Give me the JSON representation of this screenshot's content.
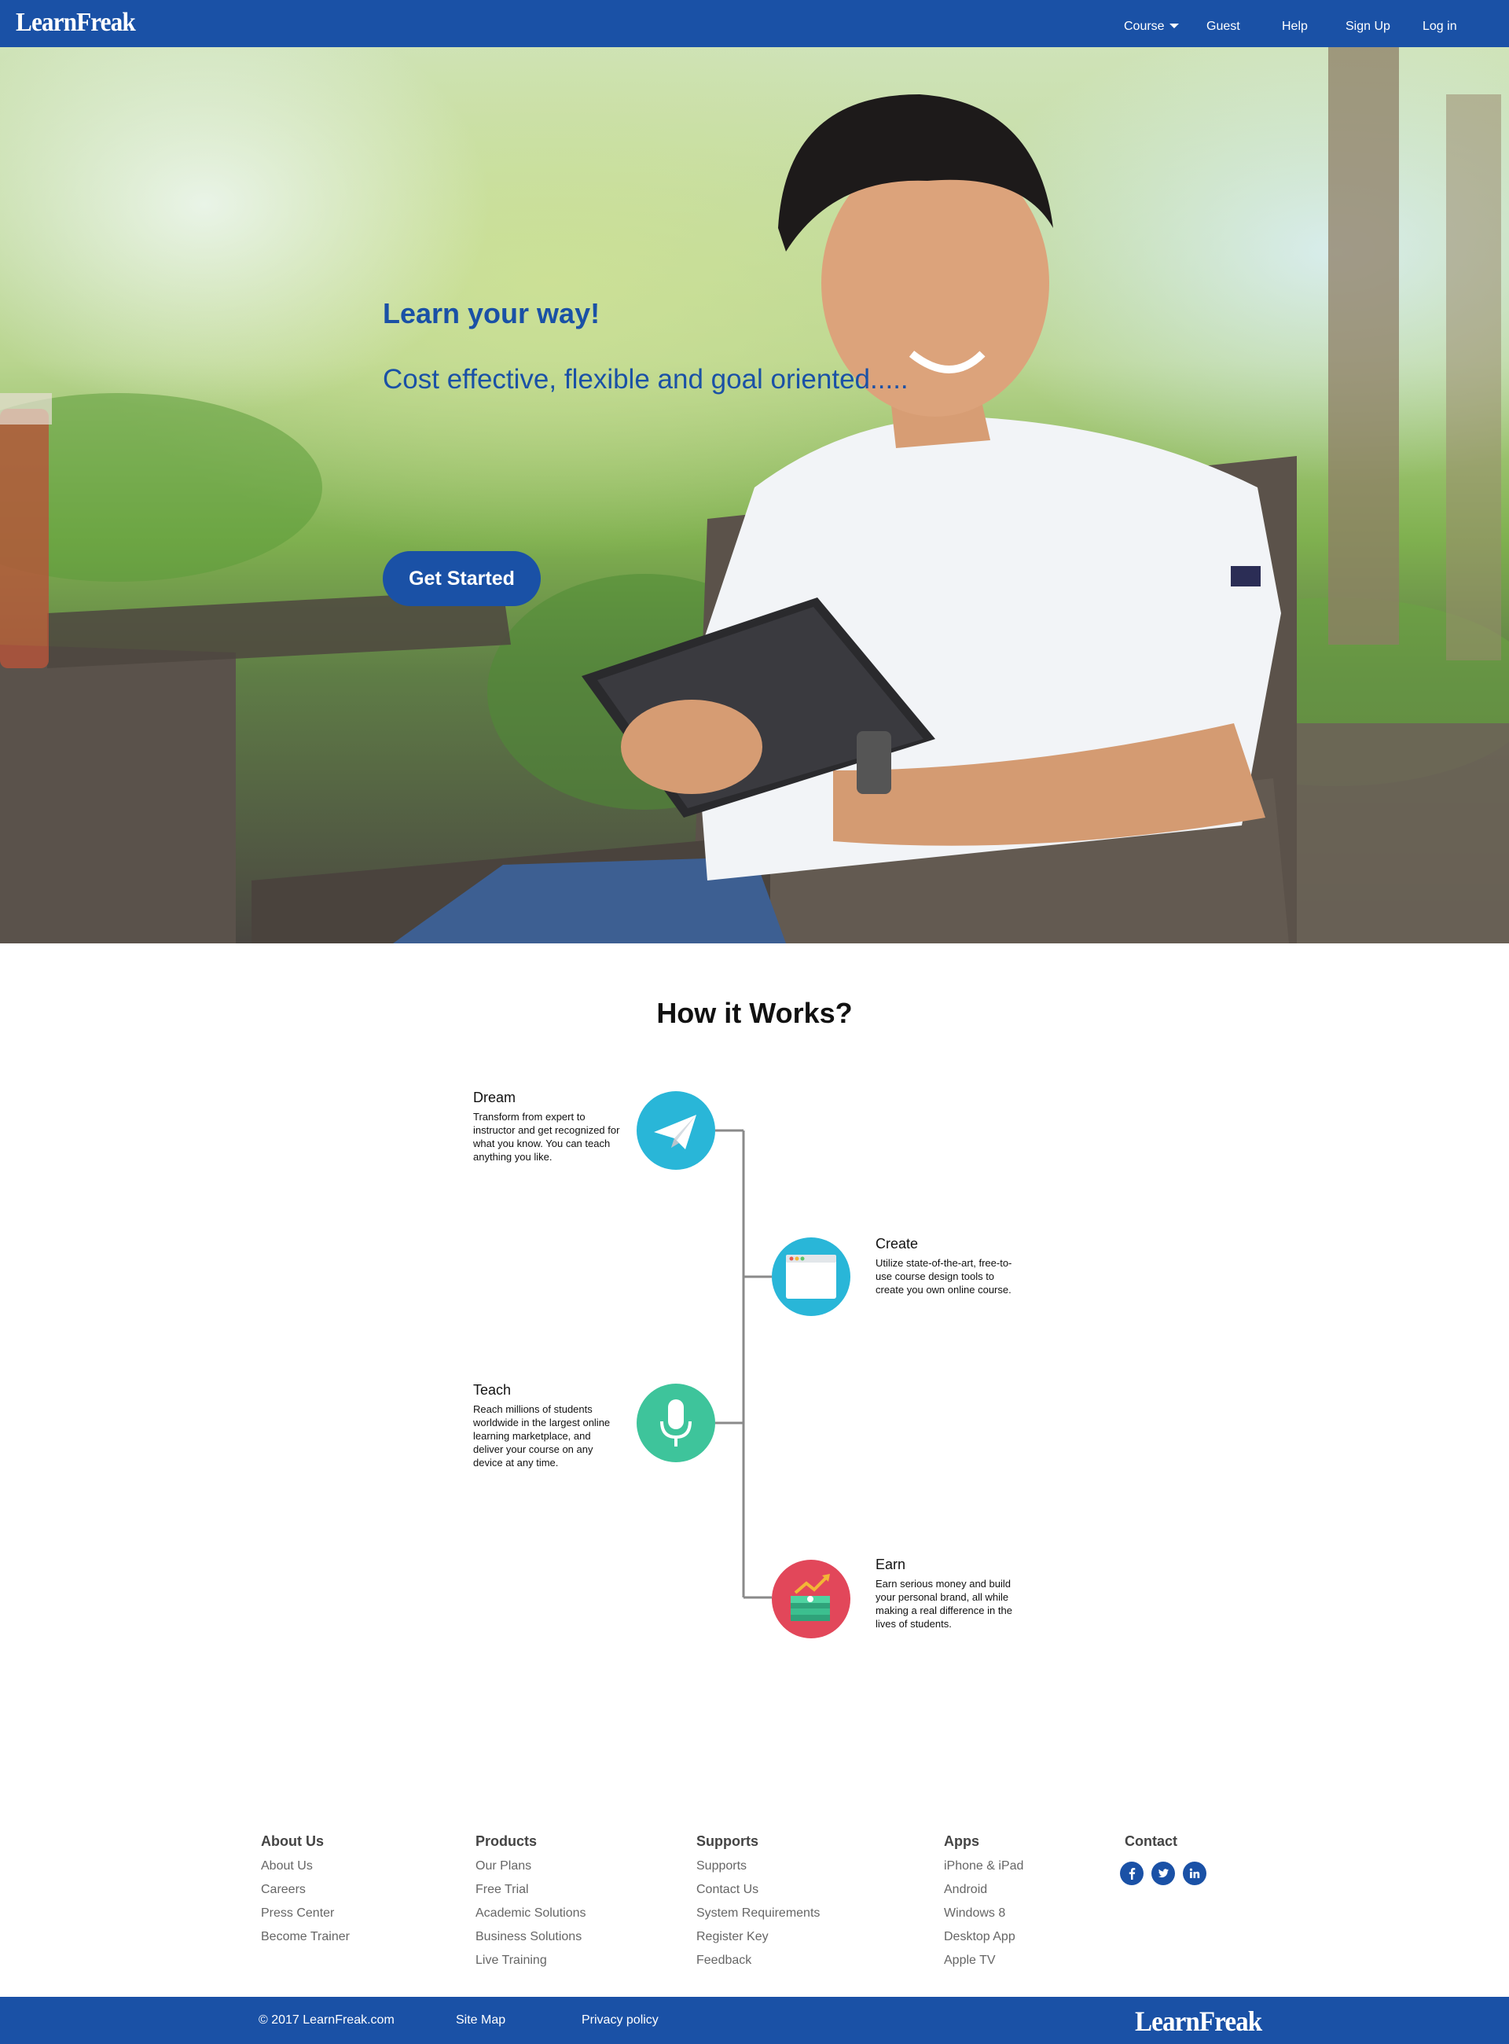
{
  "brand": {
    "name": "LearnFreak",
    "color": "#1a51a6"
  },
  "nav": {
    "items": [
      {
        "label": "Course",
        "has_dropdown": true
      },
      {
        "label": "Guest"
      },
      {
        "label": "Help"
      },
      {
        "label": "Sign Up"
      },
      {
        "label": "Log in"
      }
    ]
  },
  "hero": {
    "title": "Learn your way!",
    "subtitle": "Cost effective, flexible and goal oriented.....",
    "cta_label": "Get Started",
    "image": "man-with-tablet-photo"
  },
  "how_it_works": {
    "title": "How it Works?",
    "steps": [
      {
        "title": "Dream",
        "description": "Transform from expert to instructor and get recognized for what you know. You can teach anything you like.",
        "icon": "paper-plane-icon",
        "color": "#29b6d8"
      },
      {
        "title": "Create",
        "description": "Utilize state-of-the-art, free-to-use course design tools to create you own online course.",
        "icon": "browser-window-icon",
        "color": "#29b6d8"
      },
      {
        "title": "Teach",
        "description": "Reach millions of students worldwide in the largest online learning marketplace, and deliver your course on any device at any time.",
        "icon": "microphone-icon",
        "color": "#3ec49b"
      },
      {
        "title": "Earn",
        "description": "Earn serious money and build your personal brand, all while making a real difference in the lives of students.",
        "icon": "money-growth-icon",
        "color": "#e2475a"
      }
    ]
  },
  "footer": {
    "columns": [
      {
        "heading": "About Us",
        "links": [
          "About Us",
          "Careers",
          "Press Center",
          "Become Trainer"
        ]
      },
      {
        "heading": "Products",
        "links": [
          "Our Plans",
          "Free Trial",
          "Academic Solutions",
          "Business Solutions",
          "Live Training"
        ]
      },
      {
        "heading": "Supports",
        "links": [
          "Supports",
          "Contact Us",
          "System Requirements",
          "Register Key",
          "Feedback"
        ]
      },
      {
        "heading": "Apps",
        "links": [
          "iPhone & iPad",
          "Android",
          "Windows 8",
          "Desktop App",
          "Apple TV"
        ]
      }
    ],
    "contact": {
      "heading": "Contact",
      "social": [
        "facebook-icon",
        "twitter-icon",
        "linkedin-icon"
      ]
    },
    "bottom": {
      "copyright": "© 2017 LearnFreak.com",
      "sitemap": "Site Map",
      "privacy": "Privacy policy"
    }
  }
}
